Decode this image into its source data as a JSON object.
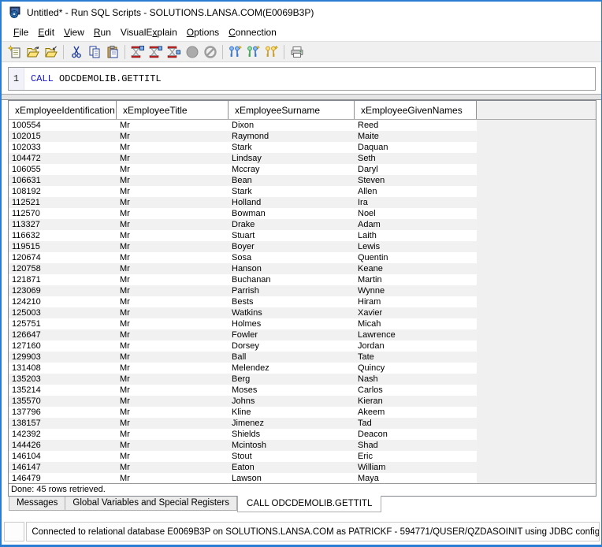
{
  "window": {
    "title": "Untitled* - Run SQL Scripts - SOLUTIONS.LANSA.COM(E0069B3P)"
  },
  "menu": {
    "items": [
      {
        "label": "File",
        "underline_index": 0
      },
      {
        "label": "Edit",
        "underline_index": 0
      },
      {
        "label": "View",
        "underline_index": 0
      },
      {
        "label": "Run",
        "underline_index": 0
      },
      {
        "label": "VisualExplain",
        "underline_index": 7
      },
      {
        "label": "Options",
        "underline_index": 0
      },
      {
        "label": "Connection",
        "underline_index": 0
      }
    ]
  },
  "toolbar": {
    "icons": [
      "new",
      "open",
      "save",
      "cut",
      "copy",
      "paste",
      "run-all",
      "run-selected",
      "run-from-selected",
      "stop",
      "cancel",
      "sql-keys-1",
      "sql-keys-2",
      "sql-keys-3",
      "print"
    ]
  },
  "editor": {
    "line_number": "1",
    "sql_keyword": "CALL",
    "sql_rest": " ODCDEMOLIB.GETTITL"
  },
  "results": {
    "columns": [
      "xEmployeeIdentification",
      "xEmployeeTitle",
      "xEmployeeSurname",
      "xEmployeeGivenNames"
    ],
    "rows": [
      [
        "100554",
        "Mr",
        "Dixon",
        "Reed"
      ],
      [
        "102015",
        "Mr",
        "Raymond",
        "Maite"
      ],
      [
        "102033",
        "Mr",
        "Stark",
        "Daquan"
      ],
      [
        "104472",
        "Mr",
        "Lindsay",
        "Seth"
      ],
      [
        "106055",
        "Mr",
        "Mccray",
        "Daryl"
      ],
      [
        "106631",
        "Mr",
        "Bean",
        "Steven"
      ],
      [
        "108192",
        "Mr",
        "Stark",
        "Allen"
      ],
      [
        "112521",
        "Mr",
        "Holland",
        "Ira"
      ],
      [
        "112570",
        "Mr",
        "Bowman",
        "Noel"
      ],
      [
        "113327",
        "Mr",
        "Drake",
        "Adam"
      ],
      [
        "116632",
        "Mr",
        "Stuart",
        "Laith"
      ],
      [
        "119515",
        "Mr",
        "Boyer",
        "Lewis"
      ],
      [
        "120674",
        "Mr",
        "Sosa",
        "Quentin"
      ],
      [
        "120758",
        "Mr",
        "Hanson",
        "Keane"
      ],
      [
        "121871",
        "Mr",
        "Buchanan",
        "Martin"
      ],
      [
        "123069",
        "Mr",
        "Parrish",
        "Wynne"
      ],
      [
        "124210",
        "Mr",
        "Bests",
        "Hiram"
      ],
      [
        "125003",
        "Mr",
        "Watkins",
        "Xavier"
      ],
      [
        "125751",
        "Mr",
        "Holmes",
        "Micah"
      ],
      [
        "126647",
        "Mr",
        "Fowler",
        "Lawrence"
      ],
      [
        "127160",
        "Mr",
        "Dorsey",
        "Jordan"
      ],
      [
        "129903",
        "Mr",
        "Ball",
        "Tate"
      ],
      [
        "131408",
        "Mr",
        "Melendez",
        "Quincy"
      ],
      [
        "135203",
        "Mr",
        "Berg",
        "Nash"
      ],
      [
        "135214",
        "Mr",
        "Moses",
        "Carlos"
      ],
      [
        "135570",
        "Mr",
        "Johns",
        "Kieran"
      ],
      [
        "137796",
        "Mr",
        "Kline",
        "Akeem"
      ],
      [
        "138157",
        "Mr",
        "Jimenez",
        "Tad"
      ],
      [
        "142392",
        "Mr",
        "Shields",
        "Deacon"
      ],
      [
        "144426",
        "Mr",
        "Mcintosh",
        "Shad"
      ],
      [
        "146104",
        "Mr",
        "Stout",
        "Eric"
      ],
      [
        "146147",
        "Mr",
        "Eaton",
        "William"
      ],
      [
        "146479",
        "Mr",
        "Lawson",
        "Maya"
      ]
    ],
    "done_status": "Done: 45 rows retrieved."
  },
  "tabs": [
    {
      "label": "Messages",
      "active": false
    },
    {
      "label": "Global Variables and Special Registers",
      "active": false
    },
    {
      "label": "CALL ODCDEMOLIB.GETTITL",
      "active": true
    }
  ],
  "statusbar": {
    "text": "Connected to relational database E0069B3P on SOLUTIONS.LANSA.COM as PATRICKF - 594771/QUSER/QZDASOINIT using JDBC configuration Default."
  },
  "colors": {
    "window_border": "#2b7cd3",
    "toolbar_bg": "#f0f0f0",
    "row_stripe": "#f1f1f1",
    "sql_keyword": "#1414d2"
  }
}
